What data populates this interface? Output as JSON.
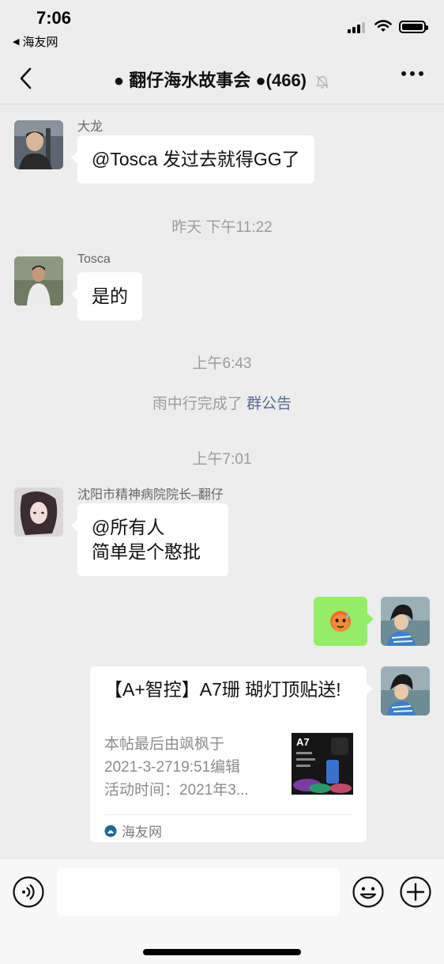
{
  "status_bar": {
    "time": "7:06",
    "back_app": "海友网"
  },
  "header": {
    "title": "● 翻仔海水故事会 ●(466)"
  },
  "messages": [
    {
      "sender": "大龙",
      "text": "@Tosca 发过去就得GG了"
    },
    {
      "sender": "Tosca",
      "text": "是的"
    },
    {
      "sender": "沈阳市精神病院院长–翻仔",
      "lines": [
        "@所有人",
        "简单是个憨批"
      ]
    }
  ],
  "timestamps": [
    "昨天 下午11:22",
    "上午6:43",
    "上午7:01"
  ],
  "system_notice": {
    "text": "雨中行完成了 ",
    "link": "群公告"
  },
  "link_card": {
    "title": "【A+智控】A7珊 瑚灯顶贴送!",
    "desc": [
      "本帖最后由飒枫于",
      "2021-3-2719:51编辑",
      "活动时间：2021年3..."
    ],
    "thumb_label": "A7",
    "source": "海友网"
  },
  "colors": {
    "bubble_green": "#95ec69",
    "link_blue": "#576b95",
    "background": "#ededed"
  },
  "icons": [
    "voice-icon",
    "emoji-icon",
    "plus-icon",
    "mute-icon",
    "back-arrow-icon",
    "more-icon"
  ]
}
